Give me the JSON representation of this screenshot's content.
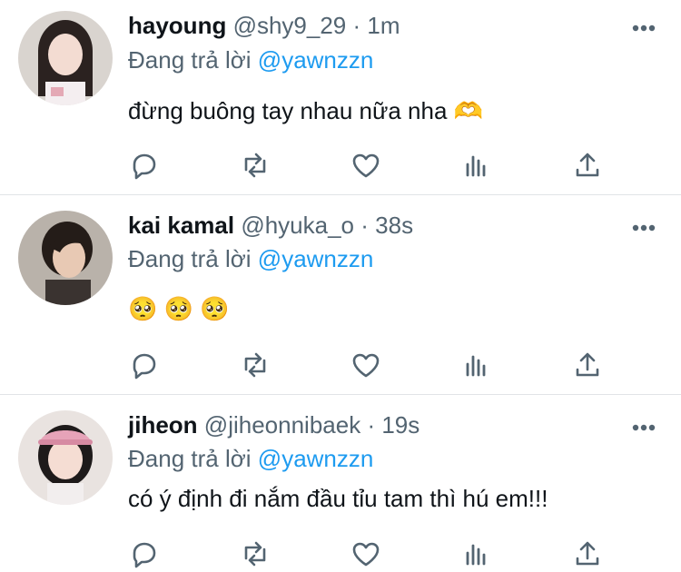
{
  "tweets": [
    {
      "name": "hayoung",
      "handle": "@shy9_29",
      "dot": "·",
      "time": "1m",
      "reply_prefix": "Đang trả lời",
      "reply_to": "@yawnzzn",
      "text": "đừng buông tay nhau nữa nha",
      "emoji": "🫶",
      "avatar_icon": "avatar-girl-dark-hair"
    },
    {
      "name": "kai kamal",
      "handle": "@hyuka_o",
      "dot": "·",
      "time": "38s",
      "reply_prefix": "Đang trả lời",
      "reply_to": "@yawnzzn",
      "text": "",
      "emoji": "🥺 🥺 🥺",
      "avatar_icon": "avatar-man-dark-hair"
    },
    {
      "name": "jiheon",
      "handle": "@jiheonnibaek",
      "dot": "·",
      "time": "19s",
      "reply_prefix": "Đang trả lời",
      "reply_to": "@yawnzzn",
      "text": "có ý định đi nắm đầu tỉu tam thì hú em!!!",
      "emoji": "",
      "avatar_icon": "avatar-girl-pink-cap"
    }
  ],
  "actions": [
    "reply-icon",
    "retweet-icon",
    "like-icon",
    "analytics-icon",
    "share-icon"
  ],
  "colors": {
    "text": "#0f1419",
    "secondary": "#536471",
    "link": "#1d9bf0",
    "divider": "#e1e4e7"
  }
}
